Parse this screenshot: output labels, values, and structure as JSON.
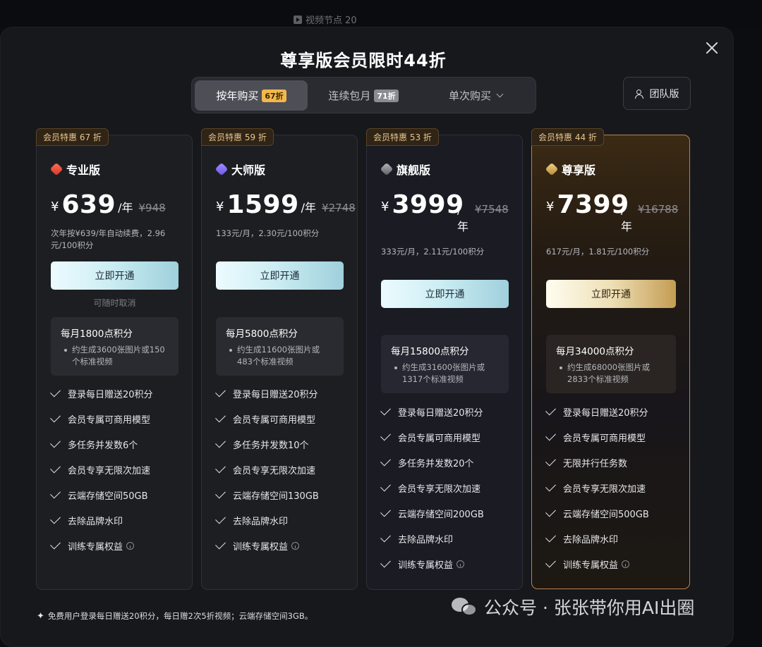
{
  "background": {
    "node_label": "视频节点 20"
  },
  "modal": {
    "title": "尊享版会员限时44折",
    "tabs": [
      {
        "label": "按年购买",
        "badge": "67折",
        "active": true
      },
      {
        "label": "连续包月",
        "badge": "71折",
        "active": false
      },
      {
        "label": "单次购买",
        "active": false
      }
    ],
    "team_button": "团队版",
    "footnote": "免费用户登录每日赠送20积分，每日赠2次5折视频；云端存储空间3GB。"
  },
  "plans": [
    {
      "promo": "会员特惠 67 折",
      "name": "专业版",
      "icon": "red-gem-icon",
      "currency": "¥",
      "price": "639",
      "unit": "/年",
      "original": "¥948",
      "subtext": "次年按¥639/年自动续费，2.96元/100积分",
      "cta": "立即开通",
      "cancel_note": "可随时取消",
      "credits_title": "每月1800点积分",
      "credits_desc": "约生成3600张图片或150个标准视频",
      "features": [
        "登录每日赠送20积分",
        "会员专属可商用模型",
        "多任务并发数6个",
        "会员专享无限次加速",
        "云端存储空间50GB",
        "去除品牌水印",
        "训练专属权益"
      ]
    },
    {
      "promo": "会员特惠 59 折",
      "name": "大师版",
      "icon": "purple-gem-icon",
      "currency": "¥",
      "price": "1599",
      "unit": "/年",
      "original": "¥2748",
      "subtext": "133元/月，2.30元/100积分",
      "cta": "立即开通",
      "credits_title": "每月5800点积分",
      "credits_desc": "约生成11600张图片或483个标准视频",
      "features": [
        "登录每日赠送20积分",
        "会员专属可商用模型",
        "多任务并发数10个",
        "会员专享无限次加速",
        "云端存储空间130GB",
        "去除品牌水印",
        "训练专属权益"
      ]
    },
    {
      "promo": "会员特惠 53 折",
      "name": "旗舰版",
      "icon": "silver-gem-icon",
      "currency": "¥",
      "price": "3999",
      "unit_top": "/",
      "unit_bottom": "年",
      "original": "¥7548",
      "subtext": "333元/月，2.11元/100积分",
      "cta": "立即开通",
      "credits_title": "每月15800点积分",
      "credits_desc": "约生成31600张图片或1317个标准视频",
      "features": [
        "登录每日赠送20积分",
        "会员专属可商用模型",
        "多任务并发数20个",
        "会员专享无限次加速",
        "云端存储空间200GB",
        "去除品牌水印",
        "训练专属权益"
      ]
    },
    {
      "promo": "会员特惠 44 折",
      "name": "尊享版",
      "icon": "gold-gem-icon",
      "currency": "¥",
      "price": "7399",
      "unit_top": "/",
      "unit_bottom": "年",
      "original": "¥16788",
      "subtext": "617元/月，1.81元/100积分",
      "cta": "立即开通",
      "credits_title": "每月34000点积分",
      "credits_desc": "约生成68000张图片或2833个标准视频",
      "features": [
        "登录每日赠送20积分",
        "会员专属可商用模型",
        "无限并行任务数",
        "会员专享无限次加速",
        "云端存储空间500GB",
        "去除品牌水印",
        "训练专属权益"
      ]
    }
  ],
  "watermark": {
    "text": "公众号 · 张张带你用AI出圈",
    "icon": "wechat-icon"
  }
}
